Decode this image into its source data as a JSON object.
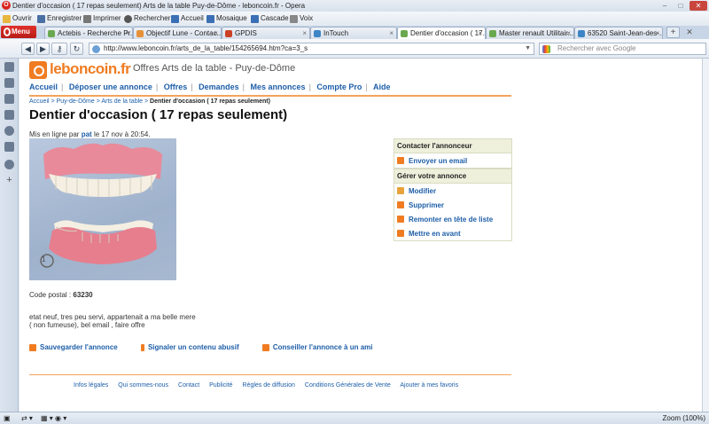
{
  "window": {
    "title": "Dentier d'occasion ( 17 repas seulement) Arts de la table Puy-de-Dôme - leboncoin.fr - Opera"
  },
  "toolbar": {
    "items": [
      "Ouvrir",
      "Enregistrer",
      "Imprimer",
      "Rechercher",
      "Accueil",
      "Mosaique",
      "Cascade",
      "Voix"
    ]
  },
  "menu_label": "Menu",
  "tabs": [
    {
      "label": "Actebis - Recherche Pr...",
      "color": "#6aa84f"
    },
    {
      "label": "Objectif Lune - Contac...",
      "color": "#e69138"
    },
    {
      "label": "GPDIS",
      "color": "#cc4125"
    },
    {
      "label": "InTouch",
      "color": "#3d85c6"
    },
    {
      "label": "Dentier d'occasion ( 17...",
      "color": "#6aa84f",
      "active": true
    },
    {
      "label": "Master renault Utilitair...",
      "color": "#6aa84f"
    },
    {
      "label": "63520 Saint-Jean-des-...",
      "color": "#3d85c6"
    }
  ],
  "address": {
    "url": "http://www.leboncoin.fr/arts_de_la_table/154265694.htm?ca=3_s",
    "search_placeholder": "Rechercher avec Google"
  },
  "site": {
    "logo_text": "leboncoin",
    "logo_suffix": ".fr",
    "header_title": "Offres Arts de la table - Puy-de-Dôme",
    "nav": [
      "Accueil",
      "Déposer une annonce",
      "Offres",
      "Demandes",
      "Mes annonces",
      "Compte Pro",
      "Aide"
    ],
    "breadcrumb": {
      "home": "Accueil",
      "region": "Puy-de-Dôme",
      "category": "Arts de la table",
      "current": "Dentier d'occasion ( 17 repas seulement)"
    }
  },
  "ad": {
    "title": "Dentier d'occasion ( 17 repas seulement)",
    "posted_prefix": "Mis en ligne par",
    "author": "pat",
    "posted_suffix": "le 17 nov à 20:54.",
    "photo_count": "1",
    "postal_label": "Code postal :",
    "postal_code": "63230",
    "description_line1": "etat neuf, tres peu servi, appartenait a ma belle mere",
    "description_line2": "( non fumeuse), bel email , faire offre"
  },
  "contact_box": {
    "header": "Contacter l'annonceur",
    "email_label": "Envoyer un email"
  },
  "manage_box": {
    "header": "Gérer votre annonce",
    "items": [
      "Modifier",
      "Supprimer",
      "Remonter en tête de liste",
      "Mettre en avant"
    ]
  },
  "actions": [
    "Sauvegarder l'annonce",
    "Signaler un contenu abusif",
    "Conseiller l'annonce à un ami"
  ],
  "footer": [
    "Infos légales",
    "Qui sommes-nous",
    "Contact",
    "Publicité",
    "Règles de diffusion",
    "Conditions Générales de Vente",
    "Ajouter à mes favoris"
  ],
  "status": {
    "zoom": "Zoom (100%)"
  },
  "colors": {
    "brand_orange": "#f07c22",
    "link_blue": "#1d5ea8",
    "opera_red": "#d9231e"
  }
}
